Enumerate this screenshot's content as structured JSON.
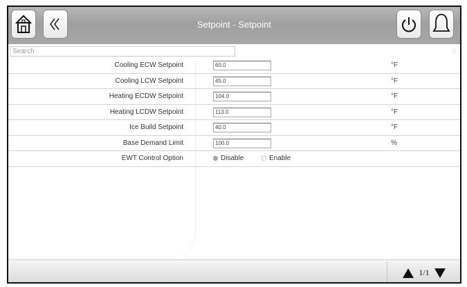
{
  "header": {
    "title": "Setpoint - Setpoint"
  },
  "search": {
    "placeholder": "Search"
  },
  "rows": [
    {
      "label": "Cooling ECW Setpoint",
      "value": "60.0",
      "unit": "°F"
    },
    {
      "label": "Cooling LCW Setpoint",
      "value": "45.0",
      "unit": "°F"
    },
    {
      "label": "Heating ECDW Setpoint",
      "value": "104.0",
      "unit": "°F"
    },
    {
      "label": "Heating LCDW Setpoint",
      "value": "113.0",
      "unit": "°F"
    },
    {
      "label": "Ice Build Setpoint",
      "value": "40.0",
      "unit": "°F"
    },
    {
      "label": "Base Demand Limit",
      "value": "100.0",
      "unit": "%"
    }
  ],
  "ewt": {
    "label": "EWT Control Option",
    "options": [
      "Disable",
      "Enable"
    ],
    "selected": "Disable"
  },
  "pager": {
    "page": "1/1"
  },
  "icons": {
    "home": "home-icon",
    "back": "back-chevron-icon",
    "power": "power-icon",
    "alarm": "bell-icon",
    "prev": "up-triangle-icon",
    "next": "down-triangle-icon"
  },
  "colors": {
    "header": "#a8a8a8",
    "title_text": "#ffffff",
    "row_divider": "#d4d4d4"
  }
}
